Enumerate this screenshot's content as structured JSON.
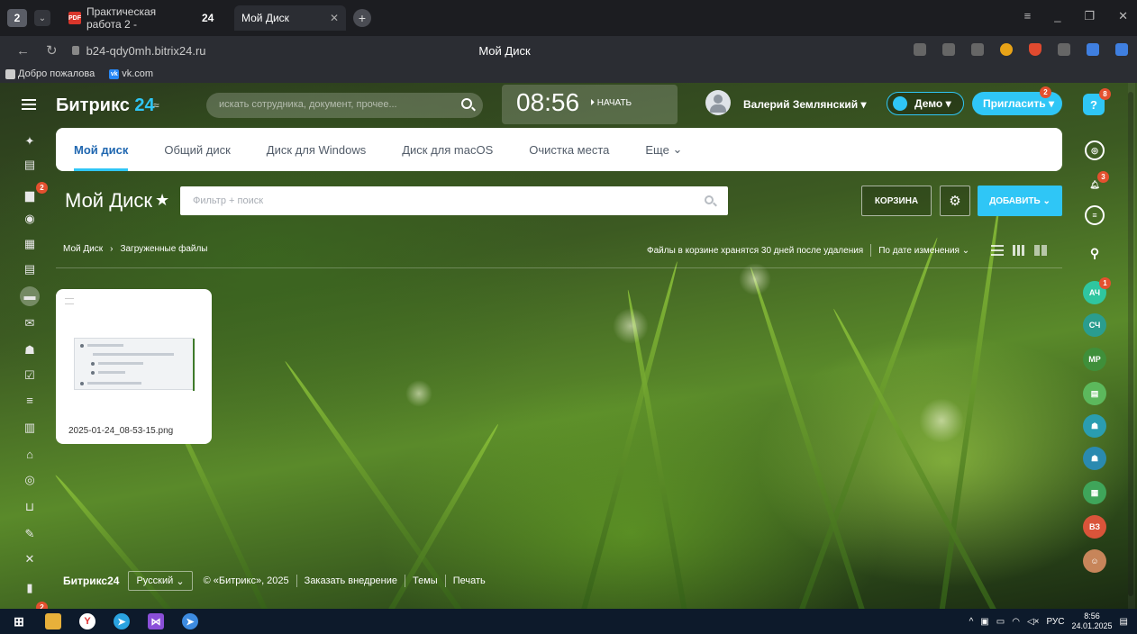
{
  "browser": {
    "tab_counter": "2",
    "tabs": [
      {
        "label": "Практическая работа 2 -"
      },
      {
        "label": "24"
      },
      {
        "label": "Мой Диск"
      }
    ],
    "address": "b24-qdy0mh.bitrix24.ru",
    "page_title": "Мой Диск",
    "bookmarks": [
      {
        "label": "Добро пожалова"
      },
      {
        "label": "vk.com"
      }
    ]
  },
  "header": {
    "logo_text": "Битрикс",
    "logo_num": "24",
    "search_placeholder": "искать сотрудника, документ, прочее...",
    "time": "08:56",
    "start_label": "НАЧАТЬ",
    "user_name": "Валерий Землянский",
    "demo_label": "Демо",
    "invite_label": "Пригласить",
    "invite_badge": "2",
    "help_badge": "8"
  },
  "left_sidebar": {
    "badges": {
      "chat": "2",
      "bottom": "2"
    }
  },
  "disk_tabs": [
    {
      "label": "Мой диск",
      "active": true
    },
    {
      "label": "Общий диск"
    },
    {
      "label": "Диск для Windows"
    },
    {
      "label": "Диск для macOS"
    },
    {
      "label": "Очистка места"
    },
    {
      "label": "Еще"
    }
  ],
  "toolbar": {
    "title": "Мой Диск",
    "filter_placeholder": "Фильтр + поиск",
    "trash_label": "КОРЗИНА",
    "add_label": "ДОБАВИТЬ"
  },
  "breadcrumb": [
    "Мой Диск",
    "Загруженные файлы"
  ],
  "info": {
    "trash_note": "Файлы в корзине хранятся 30 дней после удаления",
    "sort_label": "По дате изменения"
  },
  "files": [
    {
      "name": "2025-01-24_08-53-15.png"
    }
  ],
  "footer": {
    "logo": "Битрикс24",
    "language": "Русский",
    "copyright": "© «Битрикс», 2025",
    "order": "Заказать внедрение",
    "themes": "Темы",
    "print": "Печать"
  },
  "right_sidebar": {
    "notif_badge": "3",
    "avatars": [
      {
        "initials": "АЧ",
        "color": "#2fc6a0",
        "badge": "1"
      },
      {
        "initials": "СЧ",
        "color": "#2a9d8f"
      },
      {
        "initials": "МР",
        "color": "#3f8f3a"
      },
      {
        "initials": "ВЗ",
        "color": "#d9543a"
      }
    ]
  },
  "taskbar": {
    "lang": "РУС",
    "time": "8:56",
    "date": "24.01.2025"
  }
}
